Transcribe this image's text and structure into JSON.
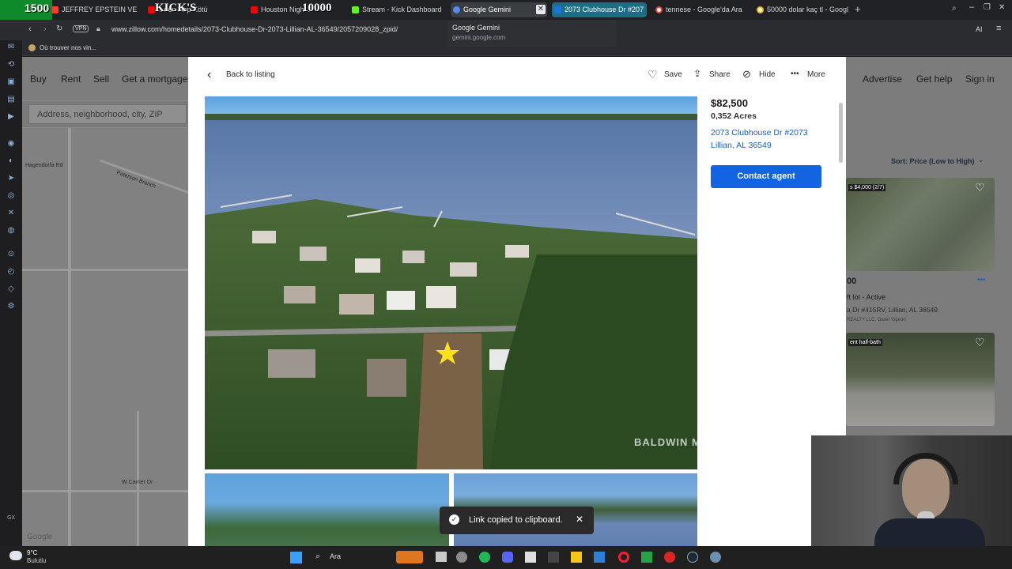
{
  "overlay": {
    "counter_left": "1500",
    "brand_text": "KICK'S",
    "counter_right": "10000"
  },
  "browser": {
    "tabs": [
      {
        "title": "JEFFREY EPSTEIN VE SA...",
        "color": "#ff4d4d"
      },
      {
        "title": "...den Hep Kötü",
        "color": "#ff0000"
      },
      {
        "title": "Houston Nigh...",
        "color": "#ff0000"
      },
      {
        "title": "Stream - Kick Dashboard",
        "color": "#53fc18"
      },
      {
        "title": "Google Gemini",
        "color": "#4f8df5"
      },
      {
        "title": "2073 Clubhouse Dr #207",
        "color": "#1b74e4"
      },
      {
        "title": "tennese - Google'da Ara",
        "color": "#ea4335"
      },
      {
        "title": "50000 dolar kaç tl - Googl",
        "color": "#fbbc05"
      }
    ],
    "tooltip": {
      "title": "Google Gemini",
      "url": "gemini.google.com"
    },
    "vpn_label": "VPN",
    "url": "www.zillow.com/homedetails/2073-Clubhouse-Dr-2073-Lillian-AL-36549/2057209028_zpid/",
    "bookmark": "Où trouver nos vin...",
    "ai_label": "AI"
  },
  "zillow": {
    "nav_left": [
      "Buy",
      "Rent",
      "Sell",
      "Get a mortgage"
    ],
    "nav_right": [
      "Advertise",
      "Get help",
      "Sign in"
    ],
    "search_placeholder": "Address, neighborhood, city, ZIP",
    "map_labels": [
      "Hagendorfa Rd",
      "Peterson Branch",
      "W Carrier Dr",
      "Google"
    ],
    "sort_label": "Sort: Price (Low to High)",
    "cards": [
      {
        "badge": "s $4,000 (2/7)",
        "price_partial": "00",
        "type": "ft lot - Active",
        "address": "a Dr #415RV, Lillian, AL 36549",
        "broker": "REALTY LLC, Gwen Vigeon"
      },
      {
        "badge": "ent half-bath"
      }
    ]
  },
  "listing": {
    "back": "Back to listing",
    "actions": [
      "Save",
      "Share",
      "Hide",
      "More"
    ],
    "price": "$82,500",
    "acres": "0,352 Acres",
    "address_line1": "2073 Clubhouse Dr #2073",
    "address_line2": "Lillian, AL 36549",
    "contact_button": "Contact agent",
    "watermark": "BALDWIN ML"
  },
  "toast": {
    "message": "Link copied to clipboard."
  },
  "taskbar": {
    "weather_temp": "9°C",
    "weather_desc": "Bulutlu",
    "search": "Ara"
  }
}
